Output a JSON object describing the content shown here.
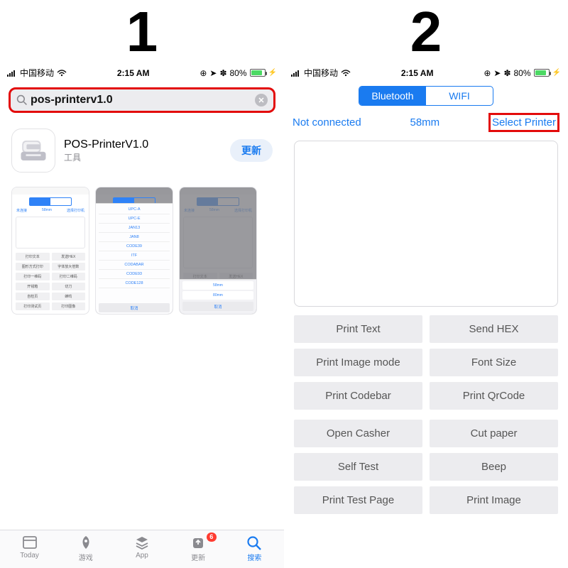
{
  "step_labels": {
    "one": "1",
    "two": "2"
  },
  "status": {
    "carrier": "中国移动",
    "time": "2:15 AM",
    "battery_pct": "80%"
  },
  "panel1": {
    "search_value": "pos-printerv1.0",
    "app_title": "POS-PrinterV1.0",
    "app_category": "工具",
    "update_label": "更新",
    "thumb_subbar": {
      "left": "未连接",
      "mid": "58mm",
      "right": "选择打印机"
    },
    "thumb1_buttons": [
      "打印文本",
      "发送HEX",
      "图形方式打印",
      "字体放大倍数",
      "打印一维码",
      "打印二维码",
      "开钱箱",
      "切刀",
      "自检页",
      "蜂鸣",
      "打印测试页",
      "打印图像"
    ],
    "thumb2_list": [
      "UPC-A",
      "UPC-E",
      "JAN13",
      "JAN8",
      "CODE39",
      "ITF",
      "CODABAR",
      "CODE93",
      "CODE128"
    ],
    "thumb2_cancel": "取消",
    "thumb3_sheet": {
      "opts": [
        "58mm",
        "80mm"
      ],
      "cancel": "取消"
    },
    "tabbar": {
      "today": "Today",
      "games": "游戏",
      "app": "App",
      "updates": "更新",
      "updates_badge": "6",
      "search": "搜索"
    }
  },
  "panel2": {
    "seg_bluetooth": "Bluetooth",
    "seg_wifi": "WIFI",
    "info_left": "Not connected",
    "info_mid": "58mm",
    "info_right": "Select Printer",
    "buttons_a": [
      "Print Text",
      "Send HEX",
      "Print Image mode",
      "Font Size",
      "Print Codebar",
      "Print QrCode"
    ],
    "buttons_b": [
      "Open Casher",
      "Cut paper",
      "Self Test",
      "Beep",
      "Print Test Page",
      "Print Image"
    ]
  }
}
